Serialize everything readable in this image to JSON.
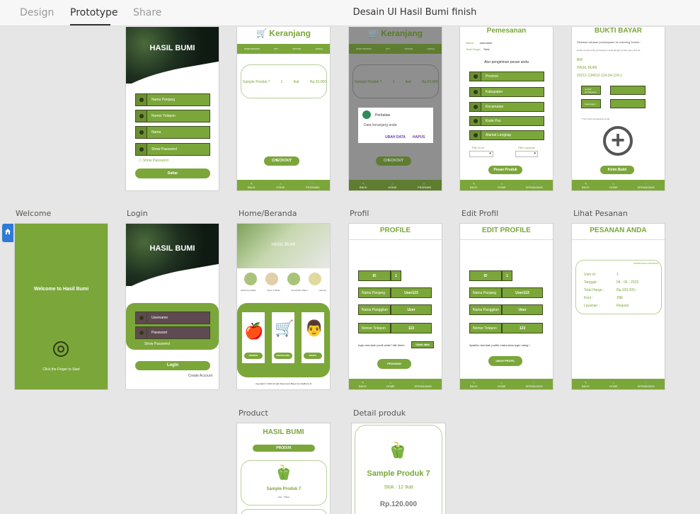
{
  "tabs": [
    {
      "label": "Design"
    },
    {
      "label": "Prototype"
    },
    {
      "label": "Share"
    }
  ],
  "doc_title": "Desain UI Hasil Bumi finish",
  "artboard_labels": {
    "welcome": "Welcome",
    "login": "Login",
    "home": "Home/Beranda",
    "profil": "Profil",
    "edit_profil": "Edit Profil",
    "lihat_pesanan": "Lihat Pesanan",
    "product": "Product",
    "detail_produk": "Detail produk"
  },
  "register": {
    "title": "HASIL BUMI",
    "fields": [
      "Nama Panjang",
      "Nomor Telepon",
      "Nama",
      "Show Password"
    ],
    "show_password": "Show Password",
    "button": "Daftar"
  },
  "keranjang": {
    "title": "Keranjang",
    "columns": [
      "NAMA PRODUK",
      "QTY",
      "SATUAN",
      "HARGA"
    ],
    "item": {
      "name": "Sample Produk 7",
      "qty": "1",
      "unit": "Ikat",
      "price": "Rp.20.000"
    },
    "checkout": "CHECKOUT"
  },
  "dialog": {
    "title": "Perhatian",
    "message": "Data keranjang anda",
    "btn_ubah": "UBAH DATA",
    "btn_hapus": "HAPUS"
  },
  "pemesanan": {
    "title": "Pemesanan",
    "nama_label": "Nama :",
    "nama_value": "username",
    "total_label": "Total Harga :",
    "total_value": "Total",
    "subtitle": "Atur pengiriman pesan anda",
    "fields": [
      "Provinsi",
      "Kabupaten",
      "Kecamatan",
      "Kode Pos",
      "Alamat Lengkap"
    ],
    "pilih_kurir": "Pilih Kurir",
    "pilih_layanan": "Pilih Layanan",
    "button": "Pesan Produk"
  },
  "bukti": {
    "title": "BUKTI BAYAR",
    "line1": "Silahkan lakukan pembayaran ke rekening berikut :",
    "line2": "Harap simpan struk pembayaran anda dengan jumlah yang diminta",
    "bank": "BRI",
    "name": "HASIL BUMI",
    "rek": "03212-134912-124-04-124-1",
    "field1": "Jumlah pembayaran",
    "field2": "Keterangan",
    "note": "* Foto bukti pembayaran anda",
    "button": "Kirim Bukti"
  },
  "nav": {
    "back": "BACK",
    "home": "HOME",
    "keranjang": "KERANJANG",
    "pesanan": "PESANAN"
  },
  "welcome": {
    "text": "Welcome to Hasil Bumi",
    "hint": "Click the Finger to Start"
  },
  "login": {
    "title": "HASIL BUMI",
    "username": "Username",
    "password": "Password",
    "show_password": "Show Password",
    "button": "Login",
    "create": "Create Account"
  },
  "home": {
    "banner": "HASIL BUMI",
    "categories": [
      "Hasil Komoditas",
      "Sayur & Buah",
      "Kebutuhan Dapur",
      "Lainnya"
    ],
    "cards": [
      "PRODUK",
      "KERANJANG",
      "PROFIL"
    ],
    "footer": "Copyright © 2022 All right Reserved | Bayan by hasilbumi id"
  },
  "profile": {
    "title": "PROFILE",
    "id_label": "ID",
    "id_value": "1",
    "rows": [
      {
        "label": "Nama Panjang",
        "value": "User123"
      },
      {
        "label": "Nama Panggilan",
        "value": "User"
      },
      {
        "label": "Nomor Telepon",
        "value": "123"
      }
    ],
    "note": "Ingin merubah profil anda? klik disini:",
    "ubah": "Ubah data",
    "button": "PESANAN"
  },
  "edit_profile": {
    "title": "EDIT PROFILE",
    "note": "Apabila merubah profile maka akan login ulang !",
    "button": "UBAH PROFIL"
  },
  "pesanan": {
    "title": "PESANAN ANDA",
    "status": "PEMBAYARAN PENDING",
    "rows": [
      {
        "label": "User id :",
        "value": "1"
      },
      {
        "label": "Tanggal :",
        "value": "04 - 05 - 2023"
      },
      {
        "label": "Total Harga :",
        "value": "Rp.100.000,-"
      },
      {
        "label": "Kurir :",
        "value": "JNE"
      },
      {
        "label": "Layanan :",
        "value": "Regular"
      }
    ]
  },
  "product": {
    "title": "HASIL BUMI",
    "tag": "PRODUK",
    "item_name": "Sample Produk 7",
    "item_stock": "Ikat : 12Ikat"
  },
  "detail": {
    "name": "Sample Produk 7",
    "stock": "Stok : 12 Ikat",
    "price": "Rp.120.000"
  },
  "colors": {
    "accent": "#7ba63a",
    "dark": "#3c4a20"
  }
}
